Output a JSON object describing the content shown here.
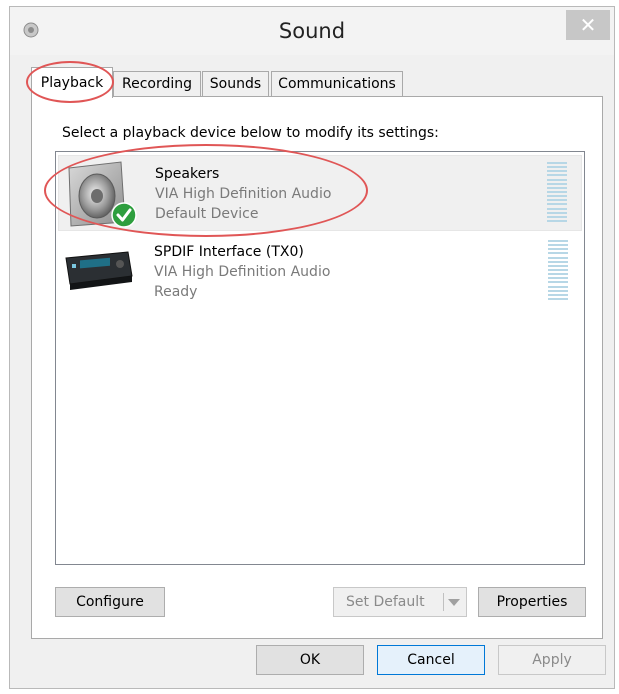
{
  "window": {
    "title": "Sound",
    "close_label": "✕"
  },
  "tabs": [
    {
      "label": "Playback",
      "active": true
    },
    {
      "label": "Recording",
      "active": false
    },
    {
      "label": "Sounds",
      "active": false
    },
    {
      "label": "Communications",
      "active": false
    }
  ],
  "playback": {
    "instruction": "Select a playback device below to modify its settings:",
    "devices": [
      {
        "name": "Speakers",
        "driver": "VIA High Definition Audio",
        "status": "Default Device",
        "icon": "speaker-icon",
        "badge": "default-check-icon",
        "selected": true
      },
      {
        "name": "SPDIF Interface (TX0)",
        "driver": "VIA High Definition Audio",
        "status": "Ready",
        "icon": "spdif-device-icon",
        "selected": false
      }
    ],
    "buttons": {
      "configure": "Configure",
      "set_default": "Set Default",
      "properties": "Properties"
    }
  },
  "footer": {
    "ok": "OK",
    "cancel": "Cancel",
    "apply": "Apply"
  },
  "colors": {
    "highlight_ring": "#e05656",
    "check_badge": "#2e9e3e",
    "meter": "#b7d7e6"
  }
}
